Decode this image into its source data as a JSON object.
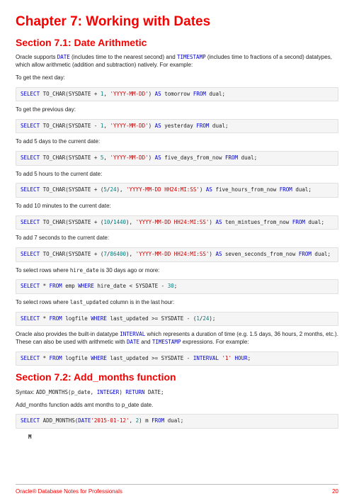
{
  "chapter_title": "Chapter 7: Working with Dates",
  "section71_title": "Section 7.1: Date Arithmetic",
  "p_intro_a": "Oracle supports ",
  "p_intro_date": "DATE",
  "p_intro_b": " (includes time to the nearest second) and ",
  "p_intro_ts": "TIMESTAMP",
  "p_intro_c": " (includes time to fractions of a second) datatypes, which allow arithmetic (addition and subtraction) natively. For example:",
  "p_nextday": "To get the next day:",
  "p_prevday": "To get the previous day:",
  "p_add5d": "To add 5 days to the current date:",
  "p_add5h": "To add 5 hours to the current date:",
  "p_add10m": "To add 10 minutes to the current date:",
  "p_add7s": "To add 7 seconds to the current date:",
  "p_sel30_a": "To select rows where ",
  "p_sel30_code": "hire_date",
  "p_sel30_b": " is 30 days ago or more:",
  "p_selhr_a": "To select rows where ",
  "p_selhr_code": "last_updated",
  "p_selhr_b": " column is in the last hour:",
  "p_interval_a": "Oracle also provides the built-in datatype ",
  "p_interval_kw": "INTERVAL",
  "p_interval_b": " which represents a duration of time (e.g. 1.5 days, 36 hours, 2 months, etc.). These can also be used with arithmetic with ",
  "p_interval_date": "DATE",
  "p_interval_c": " and ",
  "p_interval_ts": "TIMESTAMP",
  "p_interval_d": " expressions. For example:",
  "section72_title": "Section 7.2: Add_months function",
  "p_syntax_a": "Syntax: ",
  "p_syntax_code_a": "ADD_MONTHS(p_date, ",
  "p_syntax_code_int": "INTEGER",
  "p_syntax_code_b": ") ",
  "p_syntax_code_ret": "RETURN",
  "p_syntax_code_c": " DATE;",
  "p_addmonths_desc": "Add_months function adds amt months to p_date date.",
  "result_col": "M",
  "footer_left": "Oracle® Database Notes for Professionals",
  "footer_right": "20",
  "code1": {
    "select": "SELECT",
    "tochar": " TO_CHAR(SYSDATE + ",
    "num": "1",
    "comma": ", ",
    "fmt": "'YYYY-MM-DD'",
    "paren": ") ",
    "as": "AS",
    "alias": " tomorrow ",
    "from": "FROM",
    "dual": " dual;"
  },
  "code2": {
    "select": "SELECT",
    "tochar": " TO_CHAR(SYSDATE - ",
    "num": "1",
    "comma": ", ",
    "fmt": "'YYYY-MM-DD'",
    "paren": ") ",
    "as": "AS",
    "alias": " yesterday ",
    "from": "FROM",
    "dual": " dual;"
  },
  "code3": {
    "select": "SELECT",
    "tochar": " TO_CHAR(SYSDATE + ",
    "num": "5",
    "comma": ", ",
    "fmt": "'YYYY-MM-DD'",
    "paren": ") ",
    "as": "AS",
    "alias": " five_days_from_now ",
    "from": "FROM",
    "dual": " dual;"
  },
  "code4": {
    "select": "SELECT",
    "tochar": " TO_CHAR(SYSDATE + (",
    "num1": "5",
    "slash": "/",
    "num2": "24",
    "close": "), ",
    "fmt": "'YYYY-MM-DD HH24:MI:SS'",
    "paren": ") ",
    "as": "AS",
    "alias": " five_hours_from_now ",
    "from": "FROM",
    "dual": " dual;"
  },
  "code5": {
    "select": "SELECT",
    "tochar": " TO_CHAR(SYSDATE + (",
    "num1": "10",
    "slash": "/",
    "num2": "1440",
    "close": "), ",
    "fmt": "'YYYY-MM-DD HH24:MI:SS'",
    "paren": ") ",
    "as": "AS",
    "alias": " ten_mintues_from_now ",
    "from": "FROM",
    "dual": " dual;"
  },
  "code6": {
    "select": "SELECT",
    "tochar": " TO_CHAR(SYSDATE + (",
    "num1": "7",
    "slash": "/",
    "num2": "86400",
    "close": "), ",
    "fmt": "'YYYY-MM-DD HH24:MI:SS'",
    "paren": ") ",
    "as": "AS",
    "alias": " seven_seconds_from_now ",
    "from": "FROM",
    "dual": " dual;"
  },
  "code7": {
    "select": "SELECT",
    "star": " * ",
    "from": "FROM",
    "tbl": " emp ",
    "where": "WHERE",
    "cond": " hire_date < SYSDATE - ",
    "num": "30",
    "semi": ";"
  },
  "code8": {
    "select": "SELECT",
    "star": " * ",
    "from": "FROM",
    "tbl": " logfile ",
    "where": "WHERE",
    "cond": " last_updated >= SYSDATE - (",
    "num1": "1",
    "slash": "/",
    "num2": "24",
    "close": ");"
  },
  "code9": {
    "select": "SELECT",
    "star": " * ",
    "from": "FROM",
    "tbl": " logfile ",
    "where": "WHERE",
    "cond": " last_updated >= SYSDATE - ",
    "interval": "INTERVAL",
    "sp": " ",
    "val": "'1'",
    "sp2": " ",
    "hour": "HOUR",
    "semi": ";"
  },
  "code10": {
    "select": "SELECT",
    "fn": " ADD_MONTHS(",
    "date": "DATE",
    "val": "'2015-01-12'",
    "comma": ", ",
    "num": "2",
    "close": ") m ",
    "from": "FROM",
    "dual": " dual;"
  }
}
